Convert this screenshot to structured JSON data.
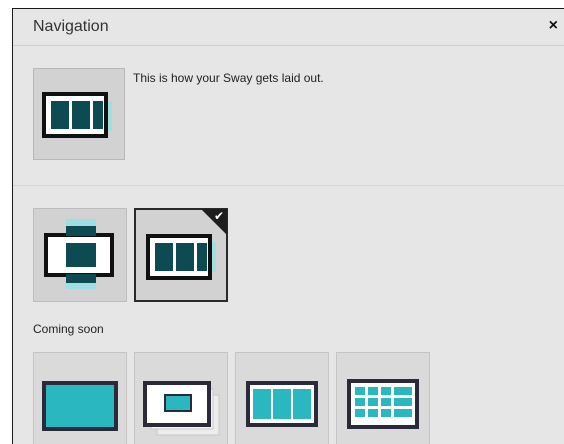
{
  "dialog": {
    "title": "Navigation",
    "close_icon": "×"
  },
  "current": {
    "description": "This is how your Sway gets laid out.",
    "icon": "horizontal-layout-icon"
  },
  "options": [
    {
      "icon": "vertical-layout-icon",
      "selected": false
    },
    {
      "icon": "horizontal-layout-icon",
      "selected": true,
      "check": "✔"
    }
  ],
  "coming_soon": {
    "label": "Coming soon",
    "items": [
      {
        "icon": "single-card-icon"
      },
      {
        "icon": "stacked-cards-icon"
      },
      {
        "icon": "three-column-icon"
      },
      {
        "icon": "grid-layout-icon"
      }
    ]
  },
  "colors": {
    "dark_teal": "#0e4a52",
    "teal": "#2bb7bf",
    "light_teal": "#9fdfe2"
  }
}
